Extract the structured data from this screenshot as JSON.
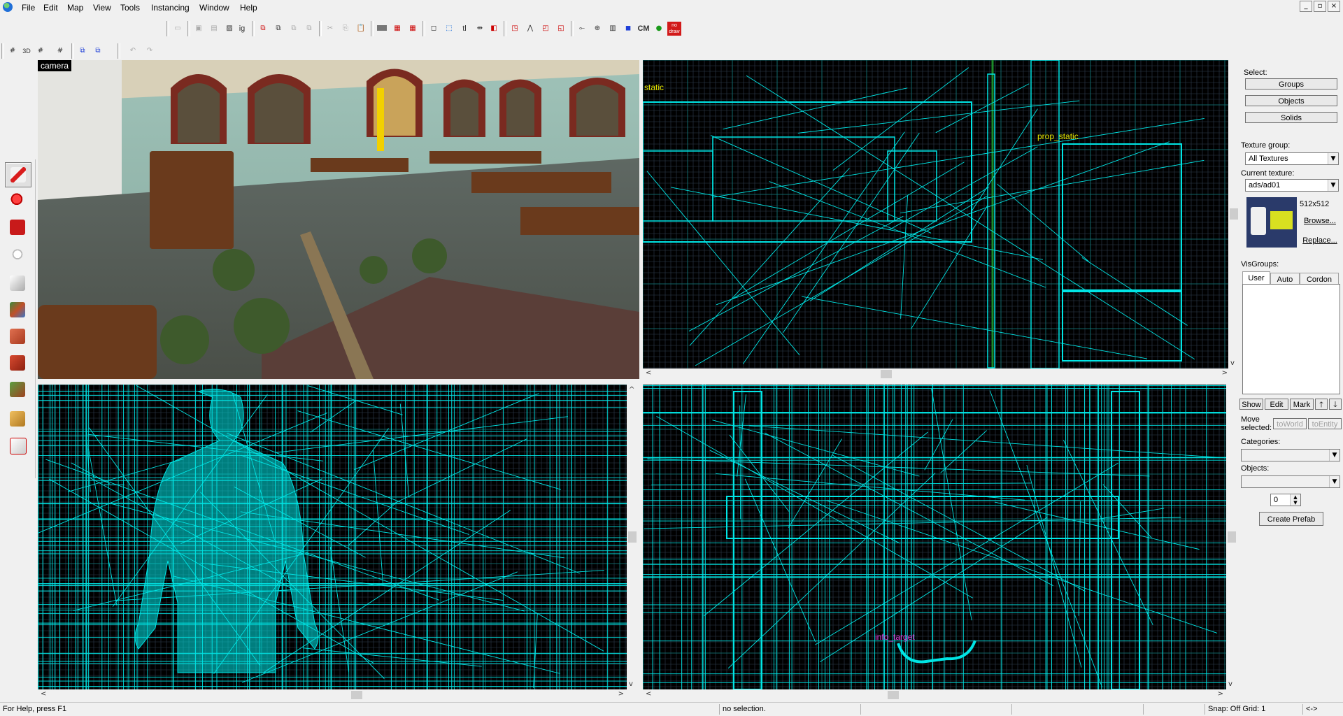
{
  "menubar": {
    "items": [
      "File",
      "Edit",
      "Map",
      "View",
      "Tools",
      "Instancing",
      "Window",
      "Help"
    ],
    "window_controls": [
      "_",
      "▫",
      "×"
    ]
  },
  "toolbar": {
    "cm_label": "CM",
    "nodraw_label": "no draw",
    "tl_label": "tl"
  },
  "viewports": {
    "camera": {
      "label": "camera"
    },
    "top_right": {
      "entity_labels": [
        "static",
        "prop_static"
      ]
    },
    "bottom_right": {
      "entity_labels": [
        "info_target"
      ]
    }
  },
  "rightpanel": {
    "select_label": "Select:",
    "buttons": {
      "groups": "Groups",
      "objects": "Objects",
      "solids": "Solids"
    },
    "texture_group_label": "Texture group:",
    "texture_group_value": "All Textures",
    "current_texture_label": "Current texture:",
    "current_texture_value": "ads/ad01",
    "texture_size": "512x512",
    "browse": "Browse...",
    "replace": "Replace...",
    "visgroups_label": "VisGroups:",
    "visgroup_tabs": [
      "User",
      "Auto",
      "Cordon"
    ],
    "vis_buttons": {
      "show": "Show",
      "edit": "Edit",
      "mark": "Mark"
    },
    "move_selected_label": "Move selected:",
    "to_world": "toWorld",
    "to_entity": "toEntity",
    "categories_label": "Categories:",
    "objects_label": "Objects:",
    "prefab_count": "0",
    "create_prefab": "Create Prefab"
  },
  "statusbar": {
    "help": "For Help, press F1",
    "selection": "no selection.",
    "snap": "Snap: Off Grid: 1",
    "arrows": "<->"
  },
  "colors": {
    "wire": "#00e5e5",
    "grid": "#2f3f4f",
    "grid_major": "#0f7a7a",
    "entity_label": "#e6e600",
    "entity_label2": "#e040e0"
  }
}
